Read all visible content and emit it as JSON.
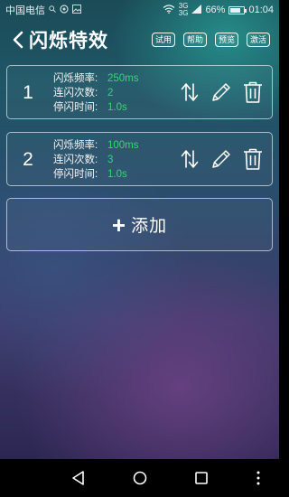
{
  "status_bar": {
    "carrier": "中国电信",
    "battery": "66%",
    "time": "01:04",
    "network_1": "3G",
    "network_2": "3G"
  },
  "header": {
    "title": "闪烁特效",
    "actions": [
      "试用",
      "帮助",
      "预览",
      "激活"
    ]
  },
  "effects": [
    {
      "index": "1",
      "frequency_label": "闪烁频率:",
      "frequency_value": "250ms",
      "count_label": "连闪次数:",
      "count_value": "2",
      "interval_label": "停闪时间:",
      "interval_value": "1.0s"
    },
    {
      "index": "2",
      "frequency_label": "闪烁频率:",
      "frequency_value": "100ms",
      "count_label": "连闪次数:",
      "count_value": "3",
      "interval_label": "停闪时间:",
      "interval_value": "1.0s"
    }
  ],
  "add_button": {
    "plus": "+",
    "label": "添加"
  },
  "icons": {
    "back": "chevron-left-icon",
    "reorder": "sort-arrows-icon",
    "edit": "pencil-icon",
    "delete": "trash-icon"
  },
  "colors": {
    "value_green": "#3ecf7a"
  }
}
